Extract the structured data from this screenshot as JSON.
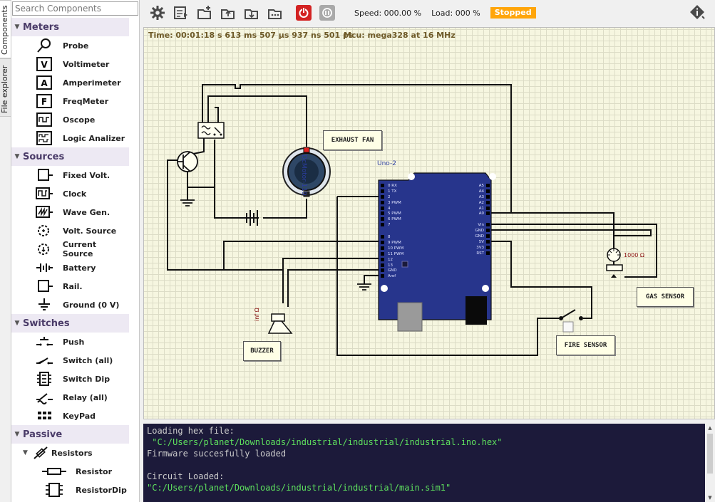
{
  "side_tabs": [
    {
      "label": "Components",
      "active": true
    },
    {
      "label": "File explorer",
      "active": false
    }
  ],
  "search": {
    "placeholder": "Search Components",
    "value": ""
  },
  "categories": [
    {
      "name": "Meters",
      "items": [
        {
          "label": "Probe",
          "icon": "probe-icon"
        },
        {
          "label": "Voltimeter",
          "icon": "voltmeter-icon"
        },
        {
          "label": "Amperimeter",
          "icon": "ammeter-icon"
        },
        {
          "label": "FreqMeter",
          "icon": "freqmeter-icon"
        },
        {
          "label": "Oscope",
          "icon": "oscilloscope-icon"
        },
        {
          "label": "Logic Analizer",
          "icon": "logic-analyzer-icon"
        }
      ]
    },
    {
      "name": "Sources",
      "items": [
        {
          "label": "Fixed Volt.",
          "icon": "fixed-volt-icon"
        },
        {
          "label": "Clock",
          "icon": "clock-icon"
        },
        {
          "label": "Wave Gen.",
          "icon": "wave-gen-icon"
        },
        {
          "label": "Volt. Source",
          "icon": "volt-source-icon"
        },
        {
          "label": "Current Source",
          "icon": "current-source-icon"
        },
        {
          "label": "Battery",
          "icon": "battery-icon"
        },
        {
          "label": "Rail.",
          "icon": "rail-icon"
        },
        {
          "label": "Ground (0 V)",
          "icon": "ground-icon"
        }
      ]
    },
    {
      "name": "Switches",
      "items": [
        {
          "label": "Push",
          "icon": "push-icon"
        },
        {
          "label": "Switch (all)",
          "icon": "switch-icon"
        },
        {
          "label": "Switch Dip",
          "icon": "switch-dip-icon"
        },
        {
          "label": "Relay (all)",
          "icon": "relay-icon"
        },
        {
          "label": "KeyPad",
          "icon": "keypad-icon"
        }
      ]
    },
    {
      "name": "Passive",
      "subcategory": "Resistors",
      "items": [
        {
          "label": "Resistor",
          "icon": "resistor-icon"
        },
        {
          "label": "ResistorDip",
          "icon": "resistor-dip-icon"
        }
      ]
    }
  ],
  "toolbar": {
    "icons": [
      "gear-icon",
      "open-circuit-icon",
      "new-circuit-icon",
      "open-folder-icon",
      "save-icon",
      "save-as-icon",
      "power-on-icon",
      "pause-icon"
    ],
    "speed_label": "Speed: 000.00 %",
    "load_label": "Load: 000 %",
    "status": "Stopped",
    "status_color": "#ffa50a",
    "info_icon": "info-icon"
  },
  "canvas": {
    "time": "Time: 00:01:18 s  613 ms  507 µs  937 ns  501 ps",
    "mcu": "Mcu: mega328 at 16 MHz",
    "board_label": "Uno-2",
    "motor_label": "DcMotor-119",
    "buzzer_value": "inf Ω",
    "pot_value": "1000 Ω",
    "labels": {
      "exhaust_fan": "EXHAUST FAN",
      "buzzer": "BUZZER",
      "fire_sensor": "FIRE SENSOR",
      "gas_sensor": "GAS SENSOR"
    },
    "pins_left": [
      "0 RX",
      "1 TX",
      "2",
      "3  PWM",
      "4",
      "5  PWM",
      "6  PWM",
      "7",
      "8",
      "9  PWM",
      "10 PWM",
      "11 PWM",
      "12",
      "13",
      "GND",
      "Aref"
    ],
    "pins_right": [
      "A5",
      "A4",
      "A3",
      "A2",
      "A1",
      "A0",
      "Vin",
      "GND",
      "GND",
      "5V",
      "3V3",
      "RST"
    ]
  },
  "console": {
    "lines": [
      {
        "text": "Loading hex file:",
        "type": "normal"
      },
      {
        "text": " \"C:/Users/planet/Downloads/industrial/industrial/industrial.ino.hex\"",
        "type": "path"
      },
      {
        "text": "Firmware succesfully loaded",
        "type": "normal"
      },
      {
        "text": "",
        "type": "normal"
      },
      {
        "text": "Circuit Loaded:",
        "type": "normal"
      },
      {
        "text": "\"C:/Users/planet/Downloads/industrial/industrial/main.sim1\"",
        "type": "path"
      }
    ]
  }
}
